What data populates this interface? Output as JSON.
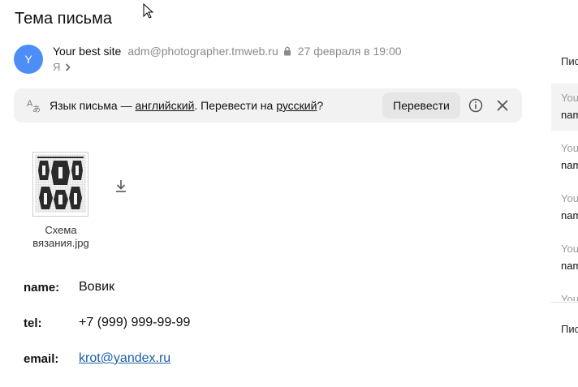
{
  "email": {
    "subject": "Тема письма",
    "avatar_letter": "Y",
    "sender_name": "Your best site",
    "sender_email": "adm@photographer.tmweb.ru",
    "date": "27 февраля в 19:00",
    "recipient": "Я"
  },
  "translate": {
    "text_prefix": "Язык письма — ",
    "source_lang": "английский",
    "text_middle": ". Перевести на ",
    "target_lang": "русский",
    "text_suffix": "?",
    "button_label": "Перевести"
  },
  "attachment": {
    "filename": "Схема вязания.jpg"
  },
  "fields": [
    {
      "label": "name:",
      "value": "Вовик"
    },
    {
      "label": "tel:",
      "value": "+7 (999) 999-99-99"
    },
    {
      "label": "email:",
      "value": "krot@yandex.ru"
    }
  ],
  "right_panel": {
    "header_top": "Пис",
    "header_bottom": "Пис",
    "items": [
      {
        "line1": "You",
        "line2": "nam"
      },
      {
        "line1": "You",
        "line2": "nam"
      },
      {
        "line1": "You",
        "line2": "nam"
      },
      {
        "line1": "You",
        "line2": "nam"
      },
      {
        "line1": "You",
        "line2": ""
      }
    ]
  },
  "colors": {
    "avatar": "#4c8df6",
    "link": "#1a5fa8",
    "translate_bar_bg": "#f2f2f2"
  },
  "icons": [
    "cursor-arrow-icon",
    "lock-icon",
    "chevron-right-icon",
    "translate-icon",
    "info-icon",
    "close-icon",
    "download-icon"
  ]
}
